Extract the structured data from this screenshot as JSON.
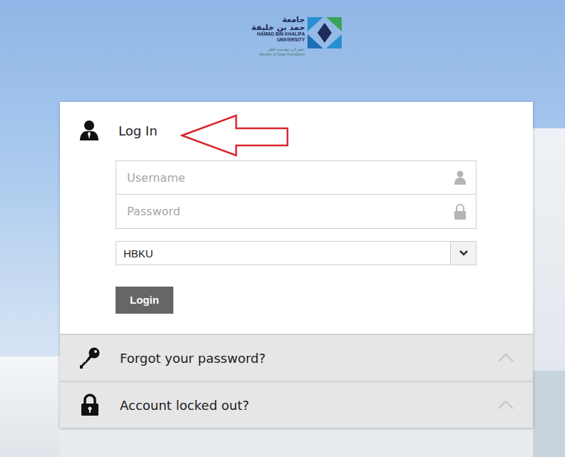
{
  "logo": {
    "arabic_line1": "جامعة",
    "arabic_line2": "حمد بن خليفة",
    "english_line1": "HAMAD BIN KHALIFA",
    "english_line2": "UNIVERSITY",
    "arabic_tagline": "عضو في مؤسسة قطر",
    "english_tagline": "Member of Qatar Foundation"
  },
  "login": {
    "title": "Log In",
    "username": {
      "placeholder": "Username"
    },
    "password": {
      "placeholder": "Password"
    },
    "domain": {
      "value": "HBKU"
    },
    "button": "Login"
  },
  "panels": [
    {
      "label": "Forgot your password?",
      "expanded": false,
      "kind": "key"
    },
    {
      "label": "Account locked out?",
      "expanded": false,
      "kind": "lock"
    }
  ]
}
